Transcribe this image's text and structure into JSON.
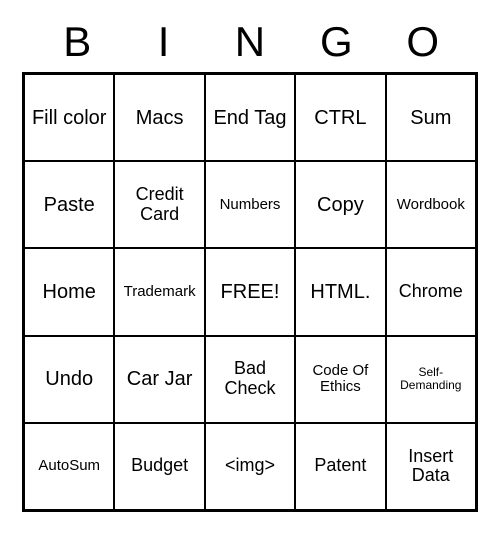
{
  "header": [
    "B",
    "I",
    "N",
    "G",
    "O"
  ],
  "cells": [
    [
      "Fill color",
      "Macs",
      "End Tag",
      "CTRL",
      "Sum"
    ],
    [
      "Paste",
      "Credit Card",
      "Numbers",
      "Copy",
      "Wordbook"
    ],
    [
      "Home",
      "Trademark",
      "FREE!",
      "HTML.",
      "Chrome"
    ],
    [
      "Undo",
      "Car Jar",
      "Bad Check",
      "Code Of Ethics",
      "Self-Demanding"
    ],
    [
      "AutoSum",
      "Budget",
      "<img>",
      "Patent",
      "Insert Data"
    ]
  ]
}
